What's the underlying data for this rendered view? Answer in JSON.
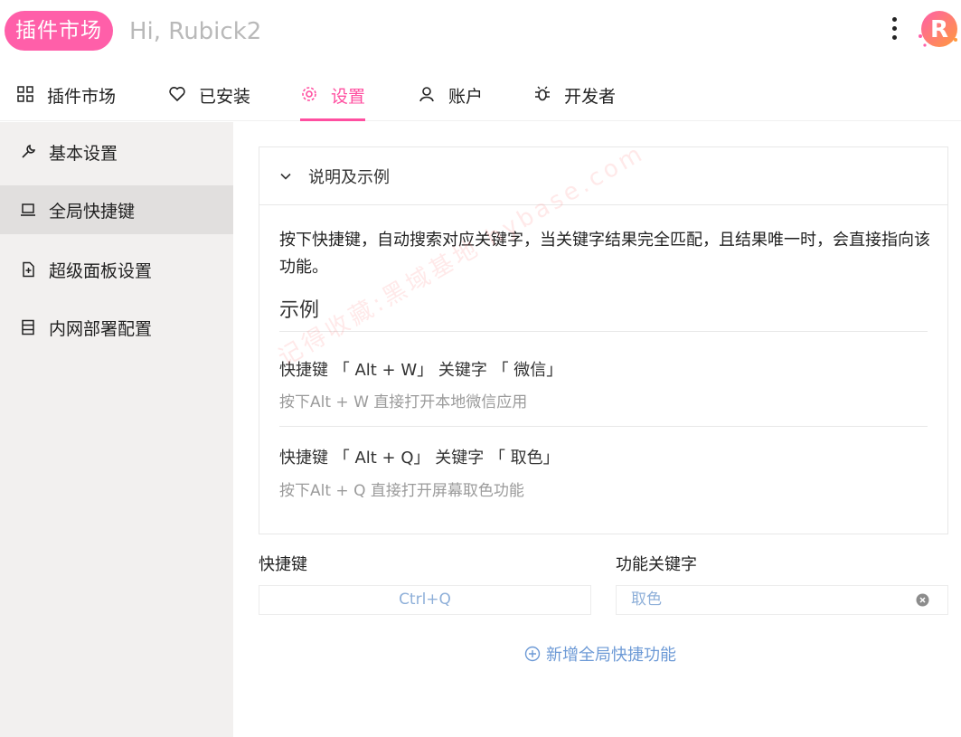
{
  "header": {
    "brand": "插件市场",
    "greeting": "Hi, Rubick2",
    "more_icon": "more-vertical-icon",
    "avatar_icon": "rubick-logo"
  },
  "nav": {
    "tabs": [
      {
        "label": "插件市场",
        "icon": "grid-icon"
      },
      {
        "label": "已安装",
        "icon": "heart-icon"
      },
      {
        "label": "设置",
        "icon": "gear-icon",
        "active": true
      },
      {
        "label": "账户",
        "icon": "user-icon"
      },
      {
        "label": "开发者",
        "icon": "bug-icon"
      }
    ]
  },
  "sidebar": {
    "items": [
      {
        "label": "基本设置",
        "icon": "wrench-icon"
      },
      {
        "label": "全局快捷键",
        "icon": "laptop-icon",
        "active": true
      },
      {
        "label": "超级面板设置",
        "icon": "file-add-icon"
      },
      {
        "label": "内网部署配置",
        "icon": "database-icon"
      }
    ]
  },
  "panel": {
    "title": "说明及示例",
    "description": "按下快捷键，自动搜索对应关键字，当关键字结果完全匹配，且结果唯一时，会直接指向该功能。",
    "example_title": "示例",
    "examples": [
      {
        "main": "快捷键 「 Alt + W」 关键字 「 微信」",
        "sub": "按下Alt + W 直接打开本地微信应用"
      },
      {
        "main": "快捷键 「 Alt + Q」 关键字 「 取色」",
        "sub": "按下Alt + Q 直接打开屏幕取色功能"
      }
    ]
  },
  "watermark": "记得收藏:黑域基地 hybase.com",
  "form": {
    "hotkey_label": "快捷键",
    "keyword_label": "功能关键字",
    "hotkey_value": "Ctrl+Q",
    "keyword_value": "取色",
    "add_label": "新增全局快捷功能"
  },
  "colors": {
    "accent": "#ff4fa0",
    "brand_pill": "#ff5fa9",
    "link": "#6d9ad6",
    "sidebar_bg": "#f2f0ef",
    "sidebar_active": "#e1dfde"
  }
}
